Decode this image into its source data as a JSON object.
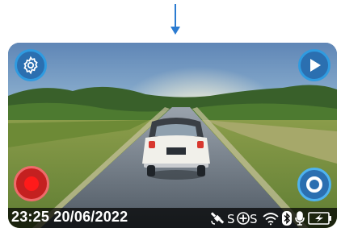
{
  "camera": {
    "datetime": "23:25 20/06/2022",
    "controls": {
      "settings_icon": "gear-icon",
      "playback_icon": "play-icon",
      "record_icon": "record-icon",
      "capture_icon": "shutter-icon"
    },
    "status_icons": [
      "satellite-icon",
      "speed-camera-icon",
      "wifi-icon",
      "bluetooth-icon",
      "microphone-icon",
      "battery-charging-icon"
    ],
    "accent_color": "#2f9be0",
    "record_color": "#ff1a1a"
  }
}
